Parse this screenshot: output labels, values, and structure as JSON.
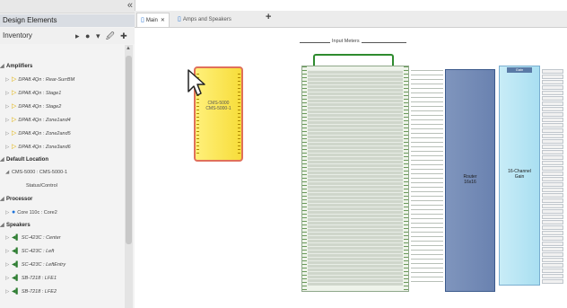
{
  "left_panel": {
    "title": "Design Elements",
    "toolbar_label": "Inventory",
    "sections": [
      {
        "header": "Amplifiers",
        "items": [
          "DPA8.4Qn : Rear-SurrBM",
          "DPA8.4Qn : Stage1",
          "DPA8.4Qn : Stage2",
          "DPA8.4Qn : Zone1and4",
          "DPA8.4Qn : Zone2and5",
          "DPA8.4Qn : Zone3and6"
        ]
      },
      {
        "header": "Default Location",
        "items": [
          "CMS-5000 : CMS-5000-1",
          "Status/Control"
        ]
      },
      {
        "header": "Processor",
        "items": [
          "Core 110c : Core2"
        ]
      },
      {
        "header": "Speakers",
        "items": [
          "SC-423C : Center",
          "SC-423C : Left",
          "SC-423C : LeftEntry",
          "SB-7218 : LFE1",
          "SB-7218 : LFE2"
        ]
      }
    ]
  },
  "tabs": [
    {
      "label": "Main",
      "active": true
    },
    {
      "label": "Amps and Speakers",
      "active": false
    }
  ],
  "canvas": {
    "input_meters_label": "Input Meters",
    "cms_block_label_line1": "CMS-5000",
    "cms_block_label_line2": "CMS-5000-1",
    "router_label_line1": "Router",
    "router_label_line2": "16x16",
    "gain_label_line1": "16-Channel",
    "gain_label_line2": "Gain",
    "gain_head": "Gain"
  },
  "colors": {
    "cms_fill": "#f7dd3a",
    "cms_border": "#e0705a",
    "router_fill": "#6a82b0",
    "gain_fill": "#a9dff1",
    "meters_bracket": "#2e8b2e"
  }
}
